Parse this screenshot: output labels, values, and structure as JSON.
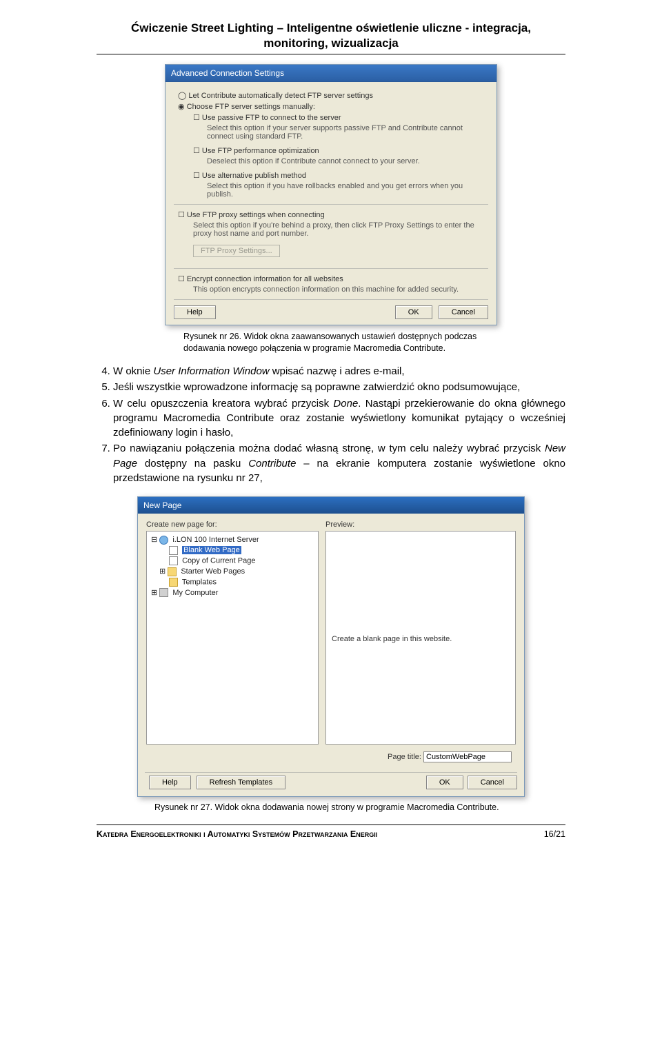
{
  "doc": {
    "title_line1": "Ćwiczenie Street Lighting – Inteligentne oświetlenie uliczne - integracja,",
    "title_line2": "monitoring, wizualizacja",
    "caption26_l1": "Rysunek nr 26. Widok okna zaawansowanych ustawień dostępnych podczas",
    "caption26_l2": "dodawania nowego połączenia w programie Macromedia Contribute.",
    "caption27": "Rysunek nr 27. Widok okna dodawania nowej strony w programie Macromedia Contribute.",
    "footer_left": "Katedra Energoelektroniki i Automatyki Systemów Przetwarzania Energii",
    "footer_right": "16/21"
  },
  "list": {
    "n4": "4.",
    "n5": "5.",
    "n6": "6.",
    "n7": "7.",
    "item4_a": "W oknie ",
    "item4_i": "User Information Window",
    "item4_b": " wpisać nazwę i adres e-mail,",
    "item5": "Jeśli wszystkie wprowadzone informację są poprawne zatwierdzić okno podsumowujące,",
    "item6_a": "W celu opuszczenia kreatora wybrać przycisk ",
    "item6_i": "Done",
    "item6_b": ". Nastąpi przekierowanie do okna głównego programu Macromedia Contribute oraz zostanie wyświetlony komunikat pytający o wcześniej zdefiniowany login i hasło,",
    "item7_a": "Po nawiązaniu połączenia można dodać własną stronę, w tym celu należy wybrać przycisk ",
    "item7_i1": "New Page",
    "item7_b": " dostępny na pasku ",
    "item7_i2": "Contribute",
    "item7_c": " – na ekranie komputera zostanie wyświetlone okno przedstawione na rysunku nr 27,"
  },
  "dialog1": {
    "title": "Advanced Connection Settings",
    "radio1": "Let Contribute automatically detect FTP server settings",
    "radio2": "Choose FTP server settings manually:",
    "chk1": "Use passive FTP to connect to the server",
    "chk1_desc": "Select this option if your server supports passive FTP and Contribute cannot connect using standard FTP.",
    "chk2": "Use FTP performance optimization",
    "chk2_desc": "Deselect this option if Contribute cannot connect to your server.",
    "chk3": "Use alternative publish method",
    "chk3_desc": "Select this option if you have rollbacks enabled and you get errors when you publish.",
    "chk4": "Use FTP proxy settings when connecting",
    "chk4_desc": "Select this option if you're behind a proxy, then click FTP Proxy Settings to enter the proxy host name and port number.",
    "proxy_btn": "FTP Proxy Settings...",
    "chk5": "Encrypt connection information for all websites",
    "chk5_desc": "This option encrypts connection information on this machine for added security.",
    "help": "Help",
    "ok": "OK",
    "cancel": "Cancel"
  },
  "dialog2": {
    "title": "New Page",
    "create_label": "Create new page for:",
    "preview_label": "Preview:",
    "tree": {
      "root": "i.LON 100 Internet Server",
      "blank": "Blank Web Page",
      "copy": "Copy of Current Page",
      "starter": "Starter Web Pages",
      "templates": "Templates",
      "mycomputer": "My Computer"
    },
    "preview_msg": "Create a blank page in this website.",
    "page_title_label": "Page title:",
    "page_title_value": "CustomWebPage",
    "help": "Help",
    "refresh": "Refresh Templates",
    "ok": "OK",
    "cancel": "Cancel"
  }
}
